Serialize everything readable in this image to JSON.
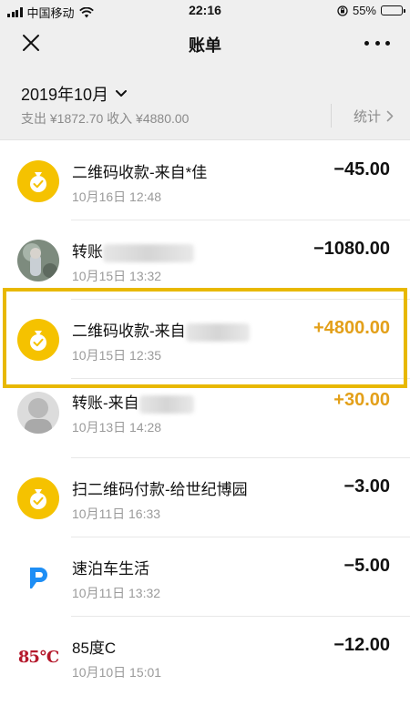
{
  "status_bar": {
    "carrier": "中国移动",
    "time": "22:16",
    "battery": "55%",
    "battery_level": 0.55
  },
  "nav": {
    "title": "账单",
    "close_icon": "close-icon",
    "more_icon": "more-icon"
  },
  "month": {
    "label": "2019年10月",
    "summary": "支出 ¥1872.70 收入 ¥4880.00",
    "stats_label": "统计"
  },
  "colors": {
    "income": "#e3a01a",
    "coin": "#f5c200",
    "highlight": "#e8b800",
    "parking_brand": "#1e8ef5",
    "brand_85c": "#b4182b"
  },
  "transactions": [
    {
      "title": "二维码收款-来自*佳",
      "time": "10月16日 12:48",
      "amount": "−45.00",
      "icon": "coin-icon"
    },
    {
      "title": "转账",
      "time": "10月15日 13:32",
      "amount": "−1080.00",
      "icon": "avatar"
    },
    {
      "title": "二维码收款-来自",
      "time": "10月15日 12:35",
      "amount": "+4800.00",
      "icon": "coin-icon"
    },
    {
      "title": "转账-来自",
      "time": "10月13日 14:28",
      "amount": "+30.00",
      "icon": "avatar"
    },
    {
      "title": "扫二维码付款-给世纪博园",
      "time": "10月11日 16:33",
      "amount": "−3.00",
      "icon": "coin-icon"
    },
    {
      "title": "速泊车生活",
      "time": "10月11日 13:32",
      "amount": "−5.00",
      "icon": "parking-logo"
    },
    {
      "title": "85度C",
      "time": "10月10日 15:01",
      "amount": "−12.00",
      "icon": "85c-logo",
      "logo_text": "85°C"
    }
  ]
}
